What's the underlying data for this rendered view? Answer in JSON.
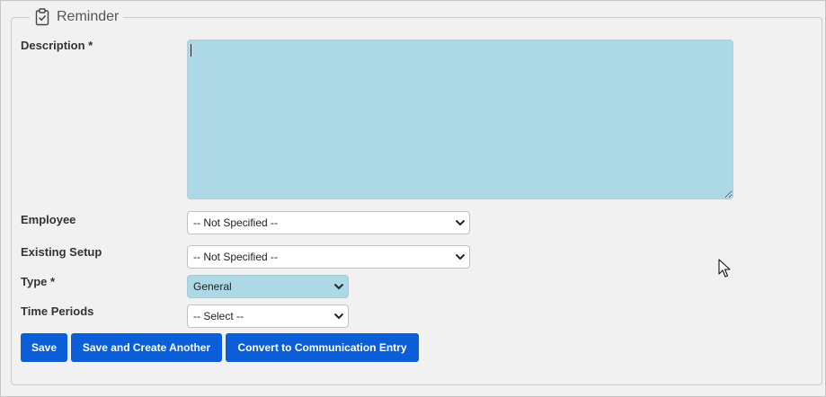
{
  "legend": {
    "title": "Reminder",
    "icon": "clipboard-check-icon"
  },
  "description": {
    "label": "Description *",
    "value": ""
  },
  "employee": {
    "label": "Employee",
    "selected": "-- Not Specified --"
  },
  "existing_setup": {
    "label": "Existing Setup",
    "selected": "-- Not Specified --"
  },
  "type": {
    "label": "Type *",
    "selected": "General"
  },
  "time_periods": {
    "label": "Time Periods",
    "selected": "-- Select --"
  },
  "buttons": {
    "save": "Save",
    "save_and_create_another": "Save and Create Another",
    "convert": "Convert to Communication Entry"
  },
  "colors": {
    "primary_button": "#0b5ed7",
    "input_highlight": "#add8e6",
    "background": "#f1f1f1"
  }
}
